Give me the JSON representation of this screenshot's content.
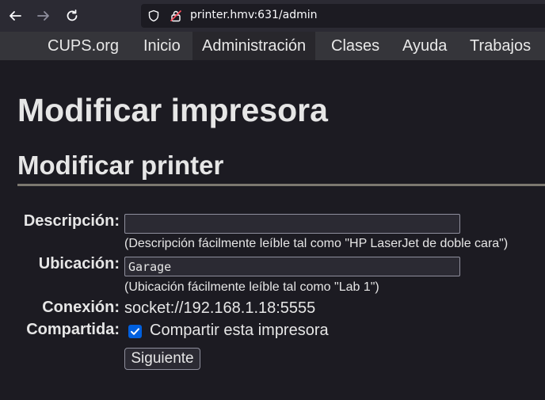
{
  "browser": {
    "back_icon": "arrow-left-icon",
    "forward_icon": "arrow-right-icon",
    "reload_icon": "reload-icon",
    "url": "printer.hmv:631/admin"
  },
  "nav": {
    "items": [
      {
        "label": "CUPS.org"
      },
      {
        "label": "Inicio"
      },
      {
        "label": "Administración",
        "active": true
      },
      {
        "label": "Clases"
      },
      {
        "label": "Ayuda"
      },
      {
        "label": "Trabajos"
      }
    ]
  },
  "page": {
    "title": "Modificar impresora",
    "subtitle": "Modificar printer"
  },
  "form": {
    "description": {
      "label": "Descripción:",
      "value": "",
      "hint": "(Descripción fácilmente leíble tal como \"HP LaserJet de doble cara\")"
    },
    "location": {
      "label": "Ubicación:",
      "value": "Garage",
      "hint": "(Ubicación fácilmente leíble tal como \"Lab 1\")"
    },
    "connection": {
      "label": "Conexión:",
      "value": "socket://192.168.1.18:5555"
    },
    "shared": {
      "label": "Compartida:",
      "checkbox_label": "Compartir esta impresora",
      "checked": true
    },
    "submit_label": "Siguiente"
  },
  "colors": {
    "background": "#1c1b22",
    "nav_background": "#35353a",
    "checkbox_accent": "#0060df"
  }
}
